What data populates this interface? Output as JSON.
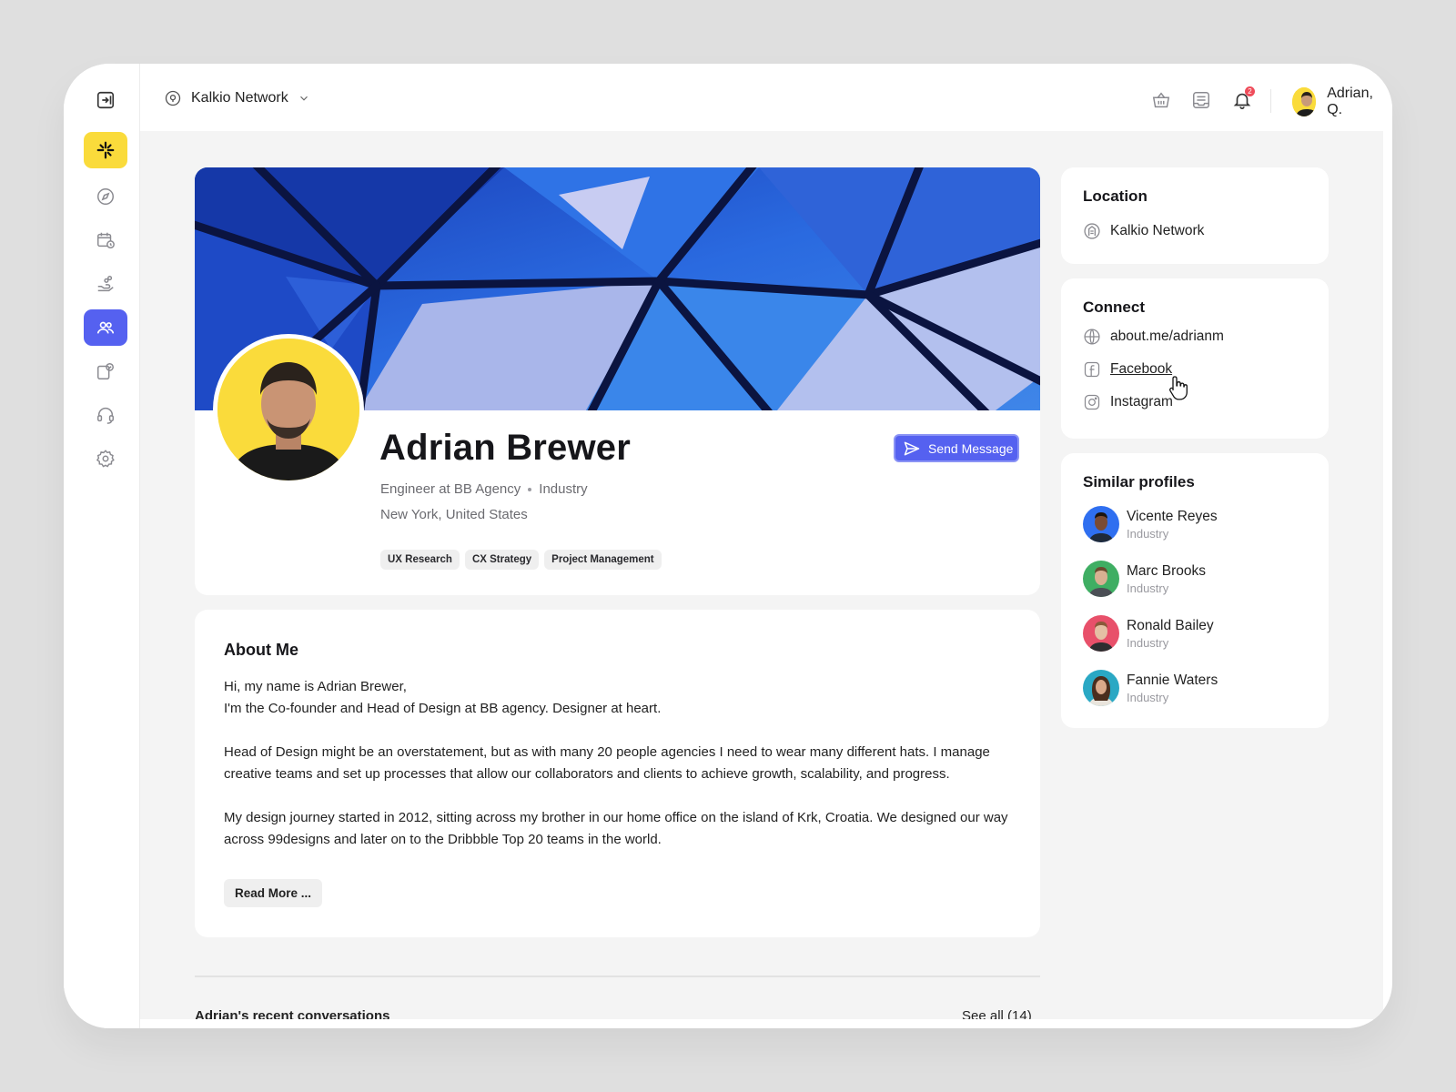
{
  "header": {
    "network_name": "Kalkio Network",
    "user_name": "Adrian, Q.",
    "notification_count": "2"
  },
  "sidebar": {
    "items": [
      {
        "icon": "collapse-sidebar-icon"
      },
      {
        "icon": "brand-logo-icon"
      },
      {
        "icon": "compass-icon"
      },
      {
        "icon": "calendar-clock-icon"
      },
      {
        "icon": "hand-money-icon"
      },
      {
        "icon": "users-icon",
        "active": true
      },
      {
        "icon": "clipboard-check-icon"
      },
      {
        "icon": "headset-icon"
      },
      {
        "icon": "gear-icon"
      }
    ]
  },
  "profile": {
    "name": "Adrian Brewer",
    "role": "Engineer at BB Agency",
    "industry": "Industry",
    "location": "New York, United States",
    "tags": [
      "UX Research",
      "CX Strategy",
      "Project Management"
    ],
    "send_message_label": "Send Message"
  },
  "about": {
    "title": "About Me",
    "line1": "Hi, my name is Adrian Brewer,",
    "line2": "I'm the Co-founder and Head of Design at BB agency. Designer at heart.",
    "paragraph2": "Head of Design might be an overstatement, but as with many 20 people agencies I need to wear many different hats. I manage creative teams and set up processes that allow our collaborators and clients to achieve growth, scalability, and progress.",
    "paragraph3": "My design journey started in 2012, sitting across my brother in our home office on the island of Krk, Croatia. We designed our way across 99designs and later on to the Dribbble Top 20 teams in the world.",
    "read_more_label": "Read More ..."
  },
  "recent": {
    "title": "Adrian's recent conversations",
    "see_all_label": "See all (14)"
  },
  "location_card": {
    "title": "Location",
    "value": "Kalkio Network"
  },
  "connect_card": {
    "title": "Connect",
    "links": [
      "about.me/adrianm",
      "Facebook",
      "Instagram"
    ]
  },
  "similar_card": {
    "title": "Similar profiles",
    "profiles": [
      {
        "name": "Vicente Reyes",
        "industry": "Industry",
        "color": "#2f6ff0"
      },
      {
        "name": "Marc Brooks",
        "industry": "Industry",
        "color": "#3fae63"
      },
      {
        "name": "Ronald Bailey",
        "industry": "Industry",
        "color": "#e8506a"
      },
      {
        "name": "Fannie Waters",
        "industry": "Industry",
        "color": "#2aa8c4"
      }
    ]
  },
  "colors": {
    "accent": "#5561f0",
    "brand_yellow": "#fadb3b",
    "badge_red": "#ef4c5a"
  }
}
